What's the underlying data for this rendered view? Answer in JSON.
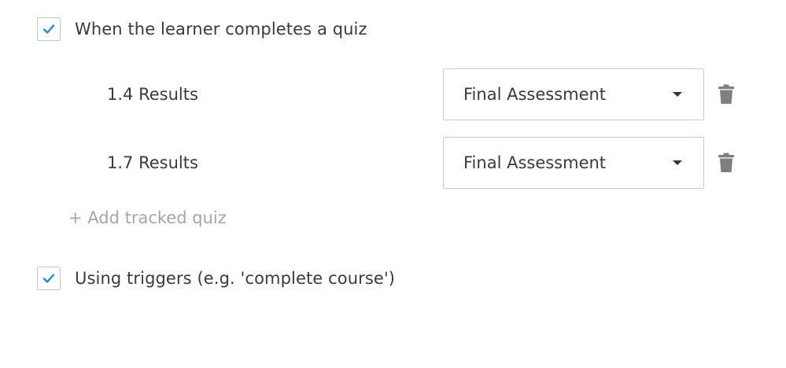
{
  "completion": {
    "quiz_option": {
      "label": "When the learner completes a quiz",
      "checked": true
    },
    "tracked_quizzes": [
      {
        "name": "1.4 Results",
        "selected": "Final Assessment"
      },
      {
        "name": "1.7 Results",
        "selected": "Final Assessment"
      }
    ],
    "add_quiz_label": "+ Add tracked quiz",
    "triggers_option": {
      "label": "Using triggers (e.g. 'complete course')",
      "checked": true
    }
  },
  "icons": {
    "checkmark": "checkmark-icon",
    "dropdown": "chevron-down-icon",
    "delete": "trash-icon"
  },
  "colors": {
    "check_accent": "#1a8fd8",
    "border": "#c8ccd0",
    "text": "#3a3a3a",
    "muted_link": "#a6a6a6",
    "trash_icon": "#7f7f7f"
  }
}
